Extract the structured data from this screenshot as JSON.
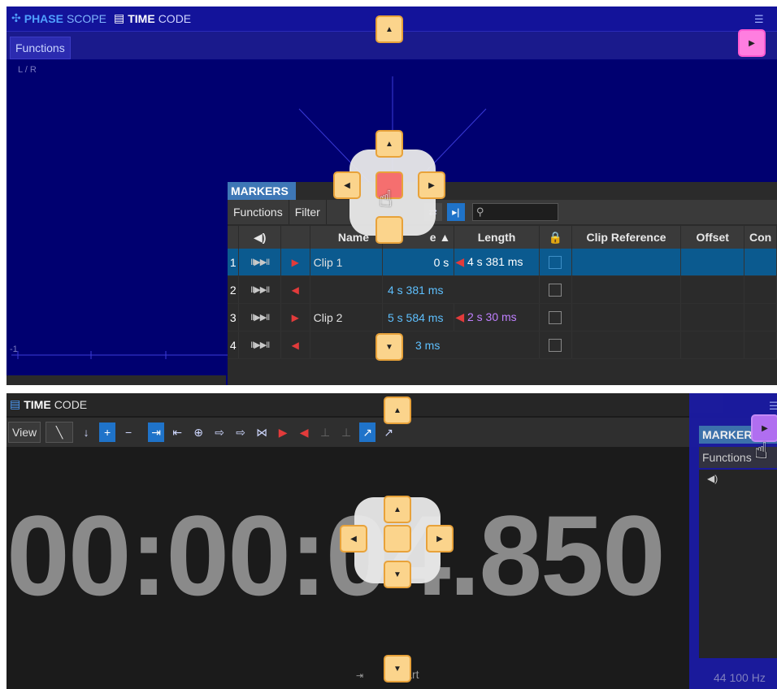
{
  "top_panel": {
    "tabs": [
      {
        "label_bold": "PHASE",
        "label_rest": "SCOPE",
        "icon": "phasescope-icon"
      },
      {
        "label_bold": "TIME",
        "label_rest": "CODE",
        "icon": "timecode-icon"
      }
    ],
    "functions_label": "Functions",
    "scope_channel_label": "L / R",
    "scope_axis_label": "-1"
  },
  "markers": {
    "title": "MARKERS",
    "toolbar": {
      "functions": "Functions",
      "filter": "Filter"
    },
    "columns": [
      "Name",
      "e",
      "Length",
      "",
      "Clip Reference",
      "Offset",
      "Con"
    ],
    "rows": [
      {
        "num": "1",
        "name": "Clip 1",
        "position": "0 s",
        "length": "4 s 381 ms",
        "selected": true
      },
      {
        "num": "2",
        "name": "",
        "position": "4 s 381 ms",
        "length": "",
        "selected": false
      },
      {
        "num": "3",
        "name": "Clip 2",
        "position": "5 s 584 ms",
        "length": "2 s 30 ms",
        "selected": false
      },
      {
        "num": "4",
        "name": "",
        "position": "3 ms",
        "length": "",
        "selected": false
      }
    ]
  },
  "bottom_panel": {
    "tab_bold": "TIME",
    "tab_rest": "CODE",
    "view_label": "View",
    "timecode_text": "00:00:04.850",
    "status_text": "art"
  },
  "overlay": {
    "markers_title": "MARKER",
    "functions_label": "Functions",
    "sample_rate": "44 100 Hz"
  },
  "colors": {
    "top_bg": "#00007a",
    "selected_row": "#0b5a8f",
    "dock_button": "#fbd48c",
    "dock_pink": "#ff7ee0",
    "dock_purple": "#b06ef0"
  }
}
